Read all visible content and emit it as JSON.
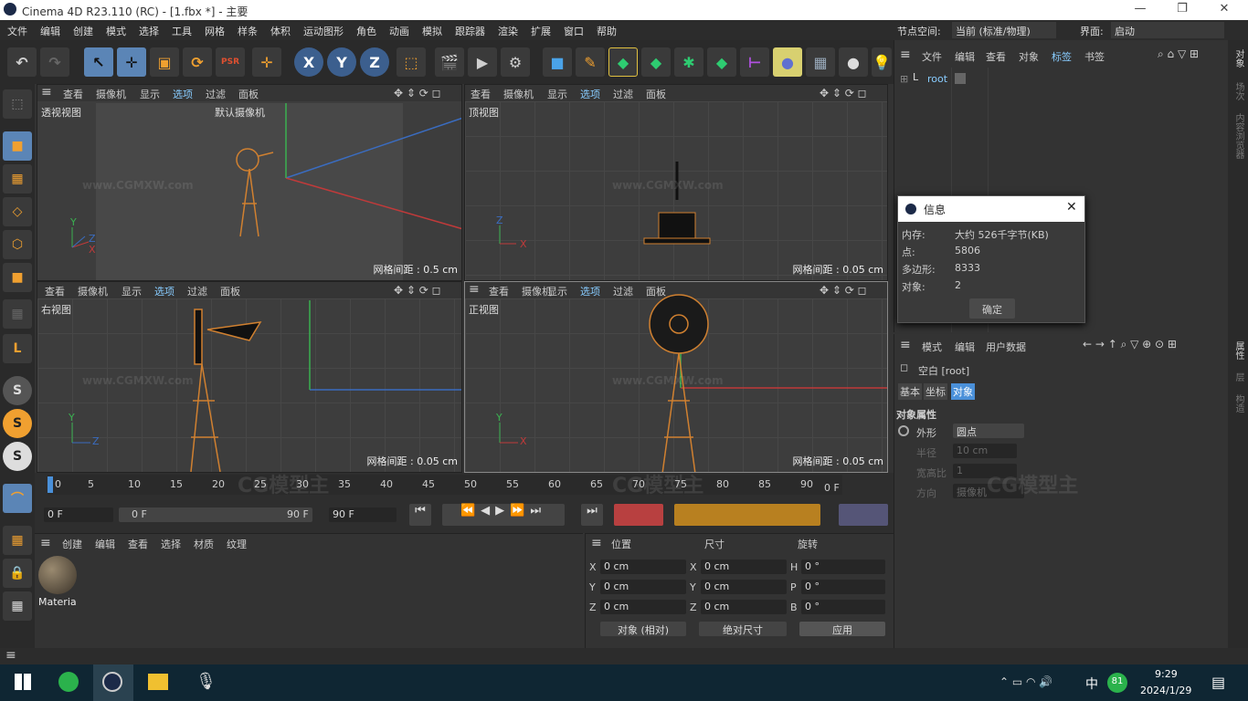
{
  "titlebar": {
    "title": "Cinema 4D R23.110 (RC) - [1.fbx *] - 主要",
    "minimize": "—",
    "restore": "❐",
    "close": "✕"
  },
  "menu": [
    "文件",
    "编辑",
    "创建",
    "模式",
    "选择",
    "工具",
    "网格",
    "样条",
    "体积",
    "运动图形",
    "角色",
    "动画",
    "模拟",
    "跟踪器",
    "渲染",
    "扩展",
    "窗口",
    "帮助"
  ],
  "menu_right": {
    "node_space_label": "节点空间:",
    "node_space_value": "当前 (标准/物理)",
    "interface_label": "界面:",
    "interface_value": "启动"
  },
  "toolbar": [
    "↶",
    "↷",
    "↖",
    "✛",
    "▣",
    "⟳",
    "PSR",
    "✛",
    "X",
    "Y",
    "Z",
    "⬚",
    "🎬",
    "▶",
    "⚙",
    "■",
    "✎",
    "◆",
    "◆",
    "✱",
    "◆",
    "⊢",
    "●",
    "▦",
    "●",
    "💡"
  ],
  "lefttools": [
    "⬚",
    "■",
    "▦",
    "◇",
    "⬡",
    "■",
    "▦",
    "L",
    "S",
    "S",
    "S",
    "⌒",
    "▦",
    "🔒",
    "▦"
  ],
  "viewports": {
    "menu": [
      "查看",
      "摄像机",
      "显示",
      "选项",
      "过滤",
      "面板"
    ],
    "persp": {
      "name": "透视视图",
      "camera": "默认摄像机",
      "grid": "网格间距 : 0.5 cm"
    },
    "top": {
      "name": "顶视图",
      "grid": "网格间距 : 0.05 cm"
    },
    "right": {
      "name": "右视图",
      "grid": "网格间距 : 0.05 cm"
    },
    "front": {
      "name": "正视图",
      "grid": "网格间距 : 0.05 cm"
    },
    "axis_y": "Y",
    "axis_x": "X",
    "axis_z": "Z"
  },
  "timeline": {
    "ticks": [
      "0",
      "5",
      "10",
      "15",
      "20",
      "25",
      "30",
      "35",
      "40",
      "45",
      "50",
      "55",
      "60",
      "65",
      "70",
      "75",
      "80",
      "85",
      "90"
    ],
    "current": "0 F",
    "start": "0 F",
    "range_start": "0 F",
    "range_end": "90 F",
    "end": "90 F"
  },
  "materials": {
    "menu": [
      "创建",
      "编辑",
      "查看",
      "选择",
      "材质",
      "纹理"
    ],
    "item": "Materia"
  },
  "coords": {
    "headers": [
      "位置",
      "尺寸",
      "旋转"
    ],
    "rows": [
      {
        "a": "X",
        "v1": "0 cm",
        "b": "X",
        "v2": "0 cm",
        "c": "H",
        "v3": "0 °"
      },
      {
        "a": "Y",
        "v1": "0 cm",
        "b": "Y",
        "v2": "0 cm",
        "c": "P",
        "v3": "0 °"
      },
      {
        "a": "Z",
        "v1": "0 cm",
        "b": "Z",
        "v2": "0 cm",
        "c": "B",
        "v3": "0 °"
      }
    ],
    "mode1": "对象 (相对)",
    "mode2": "绝对尺寸",
    "apply": "应用"
  },
  "objmgr": {
    "menu": [
      "文件",
      "编辑",
      "查看",
      "对象",
      "标签",
      "书签"
    ],
    "root": "root"
  },
  "info": {
    "title": "信息",
    "rows": [
      {
        "k": "内存:",
        "v": "大约 526千字节(KB)"
      },
      {
        "k": "点:",
        "v": "5806"
      },
      {
        "k": "多边形:",
        "v": "8333"
      },
      {
        "k": "对象:",
        "v": "2"
      }
    ],
    "ok": "确定"
  },
  "attr": {
    "menu": [
      "模式",
      "编辑",
      "用户数据"
    ],
    "object": "空白 [root]",
    "tabs": [
      "基本",
      "坐标",
      "对象"
    ],
    "section": "对象属性",
    "fields": [
      {
        "k": "外形",
        "v": "圆点"
      },
      {
        "k": "半径",
        "v": "10 cm"
      },
      {
        "k": "宽高比",
        "v": "1"
      },
      {
        "k": "方向",
        "v": "摄像机"
      }
    ]
  },
  "rightstrip": [
    "对象",
    "场次",
    "内容浏览器",
    "属性",
    "层",
    "构造"
  ],
  "taskbar": {
    "time": "9:29",
    "date": "2024/1/29",
    "ime": "中",
    "badge": "81"
  },
  "watermarks": [
    "www.CGMXW.com",
    "CG模型主"
  ]
}
